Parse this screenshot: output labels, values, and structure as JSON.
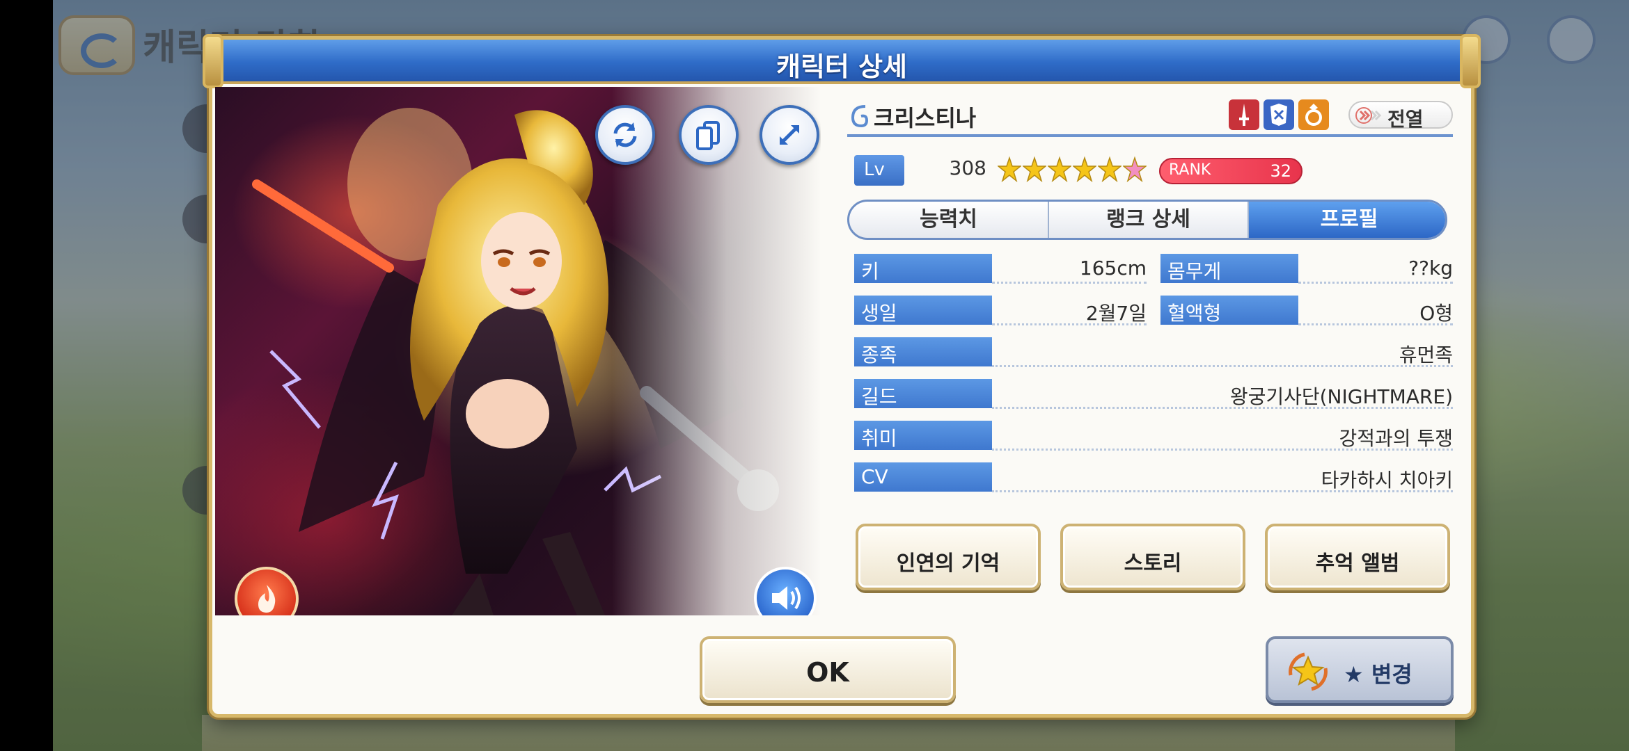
{
  "background": {
    "screen_title": "캐릭터 강화"
  },
  "dialog": {
    "title": "캐릭터 상세"
  },
  "art_controls": {
    "icons": [
      "refresh-icon",
      "card-swap-icon",
      "expand-icon"
    ],
    "element_icon": "fire-element-icon",
    "voice_icon": "speaker-icon"
  },
  "character": {
    "name": "크리스티나",
    "position": "전열",
    "role_icons": [
      "sword-icon",
      "armor-icon",
      "ring-icon"
    ],
    "level_label": "Lv",
    "level": "308",
    "stars_filled": 5,
    "stars_total": 6,
    "rank_label": "RANK",
    "rank": "32"
  },
  "tabs": [
    {
      "label": "능력치",
      "active": false
    },
    {
      "label": "랭크 상세",
      "active": false
    },
    {
      "label": "프로필",
      "active": true
    }
  ],
  "profile": {
    "height_label": "키",
    "height": "165cm",
    "weight_label": "몸무게",
    "weight": "??kg",
    "birthday_label": "생일",
    "birthday": "2월7일",
    "blood_label": "혈액형",
    "blood": "O형",
    "race_label": "종족",
    "race": "휴먼족",
    "guild_label": "길드",
    "guild": "왕궁기사단(NIGHTMARE)",
    "hobby_label": "취미",
    "hobby": "강적과의 투쟁",
    "cv_label": "CV",
    "cv": "타카하시 치아키"
  },
  "buttons": {
    "memory": "인연의 기억",
    "story": "스토리",
    "album": "추억 앨범",
    "ok": "OK",
    "change": "★ 변경"
  },
  "colors": {
    "header_blue": "#2f6cc8",
    "label_blue": "#4a84d8",
    "gold_border": "#d7b86a",
    "rank_red": "#e8344c",
    "star_gold": "#f5c518",
    "star_pink": "#f28fc0"
  }
}
